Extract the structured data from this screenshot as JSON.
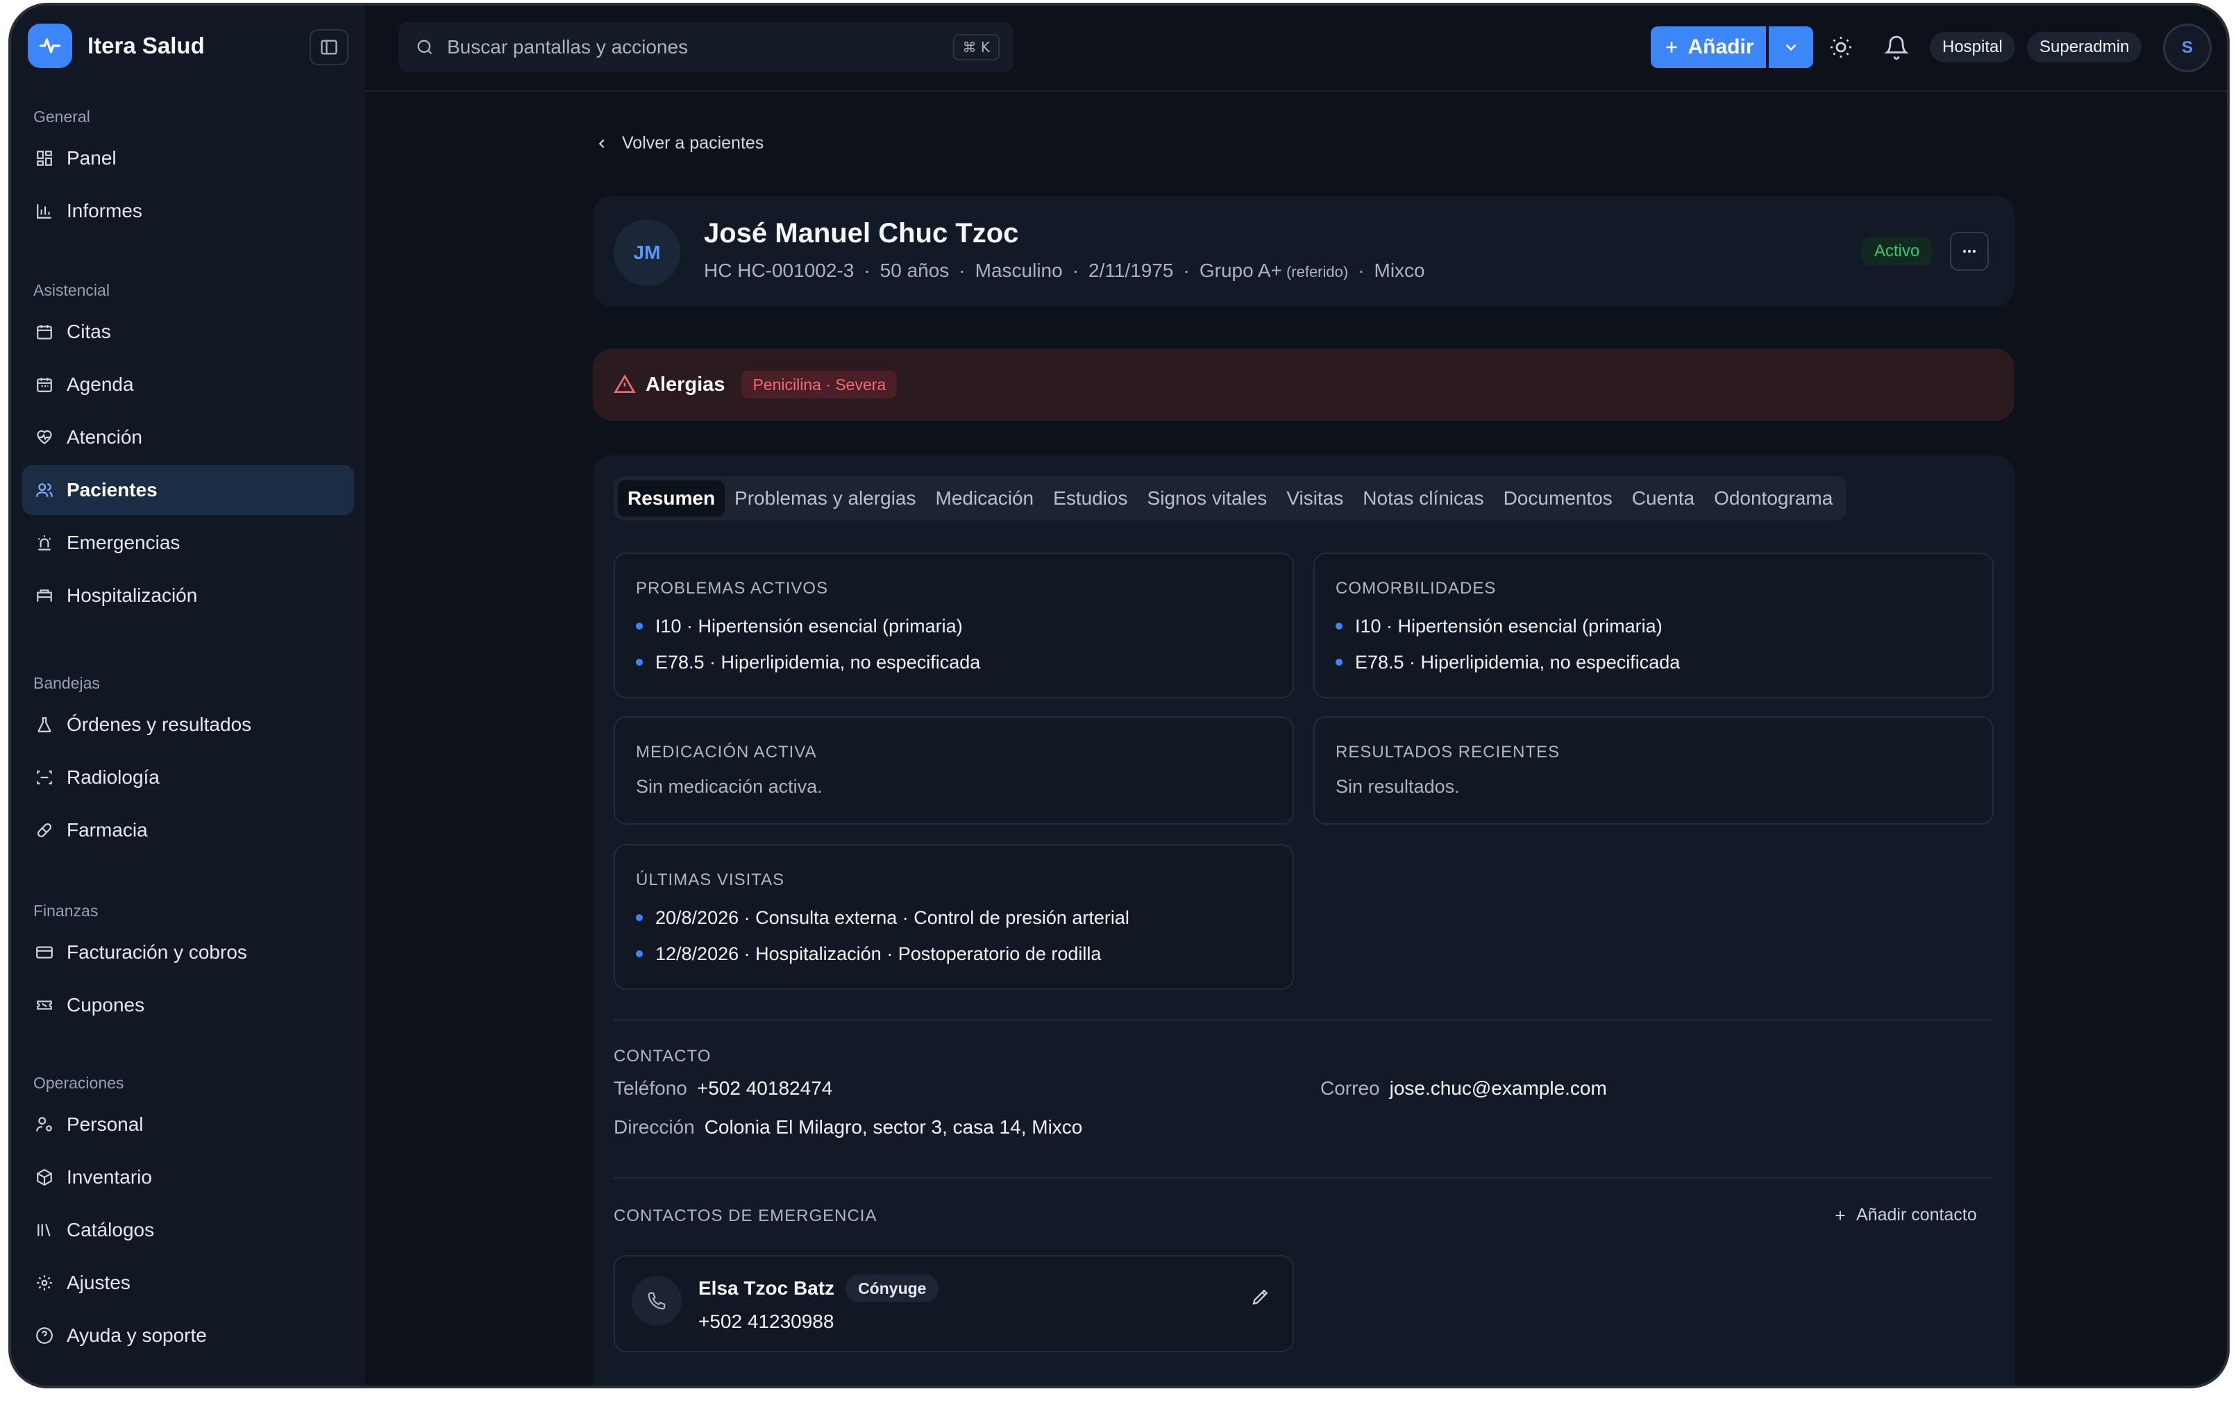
{
  "brand": {
    "name": "Itera Salud",
    "icon": "activity-icon"
  },
  "sidebar": {
    "groups": [
      {
        "title": "General",
        "items": [
          {
            "label": "Panel",
            "icon": "grid-icon"
          },
          {
            "label": "Informes",
            "icon": "bar-chart-icon"
          }
        ]
      },
      {
        "title": "Asistencial",
        "items": [
          {
            "label": "Citas",
            "icon": "calendar-icon"
          },
          {
            "label": "Agenda",
            "icon": "calendar-icon"
          },
          {
            "label": "Atención",
            "icon": "heart-pulse-icon"
          },
          {
            "label": "Pacientes",
            "icon": "users-icon",
            "active": true
          },
          {
            "label": "Emergencias",
            "icon": "siren-icon"
          },
          {
            "label": "Hospitalización",
            "icon": "bed-icon"
          }
        ]
      },
      {
        "title": "Bandejas",
        "items": [
          {
            "label": "Órdenes y resultados",
            "icon": "flask-icon"
          },
          {
            "label": "Radiología",
            "icon": "scan-icon"
          },
          {
            "label": "Farmacia",
            "icon": "pill-icon"
          }
        ]
      },
      {
        "title": "Finanzas",
        "items": [
          {
            "label": "Facturación y cobros",
            "icon": "credit-card-icon"
          },
          {
            "label": "Cupones",
            "icon": "ticket-icon"
          }
        ]
      },
      {
        "title": "Operaciones",
        "items": [
          {
            "label": "Personal",
            "icon": "user-cog-icon"
          },
          {
            "label": "Inventario",
            "icon": "package-icon"
          },
          {
            "label": "Catálogos",
            "icon": "library-icon"
          },
          {
            "label": "Ajustes",
            "icon": "gear-icon"
          },
          {
            "label": "Ayuda y soporte",
            "icon": "help-circle-icon"
          }
        ]
      }
    ]
  },
  "topbar": {
    "search_placeholder": "Buscar pantallas y acciones",
    "shortcut": "⌘ K",
    "add_label": "Añadir",
    "context_pill": "Hospital",
    "role_pill": "Superadmin",
    "user_initial": "S"
  },
  "back_link": "Volver a pacientes",
  "patient": {
    "initials": "JM",
    "name": "José Manuel Chuc Tzoc",
    "hc": "HC HC-001002-3",
    "age": "50 años",
    "sex": "Masculino",
    "birthdate": "2/11/1975",
    "blood": "Grupo A+",
    "blood_note": "(referido)",
    "city": "Mixco",
    "status": "Activo",
    "status_color": "#2ecb7b"
  },
  "allergies": {
    "title": "Alergias",
    "chip": "Penicilina · Severa",
    "color": "#f26a72"
  },
  "tabs": [
    "Resumen",
    "Problemas y alergias",
    "Medicación",
    "Estudios",
    "Signos vitales",
    "Visitas",
    "Notas clínicas",
    "Documentos",
    "Cuenta",
    "Odontograma"
  ],
  "summary": {
    "active_problems": {
      "title": "PROBLEMAS ACTIVOS",
      "items": [
        "I10 · Hipertensión esencial (primaria)",
        "E78.5 · Hiperlipidemia, no especificada"
      ]
    },
    "comorbidities": {
      "title": "COMORBILIDADES",
      "items": [
        "I10 · Hipertensión esencial (primaria)",
        "E78.5 · Hiperlipidemia, no especificada"
      ]
    },
    "medication": {
      "title": "MEDICACIÓN ACTIVA",
      "empty": "Sin medicación activa."
    },
    "results": {
      "title": "RESULTADOS RECIENTES",
      "empty": "Sin resultados."
    },
    "visits": {
      "title": "ÚLTIMAS VISITAS",
      "items": [
        "20/8/2026 · Consulta externa · Control de presión arterial",
        "12/8/2026 · Hospitalización · Postoperatorio de rodilla"
      ]
    }
  },
  "contact": {
    "title": "CONTACTO",
    "phone_label": "Teléfono",
    "phone": "+502 40182474",
    "email_label": "Correo",
    "email": "jose.chuc@example.com",
    "address_label": "Dirección",
    "address": "Colonia El Milagro, sector 3, casa 14, Mixco"
  },
  "emergency": {
    "title": "CONTACTOS DE EMERGENCIA",
    "add_label": "Añadir contacto",
    "contacts": [
      {
        "name": "Elsa Tzoc Batz",
        "relation": "Cónyuge",
        "phone": "+502 41230988"
      }
    ]
  },
  "colors": {
    "accent": "#3d86f7",
    "background": "#0c111a",
    "sidebar": "#111824"
  }
}
